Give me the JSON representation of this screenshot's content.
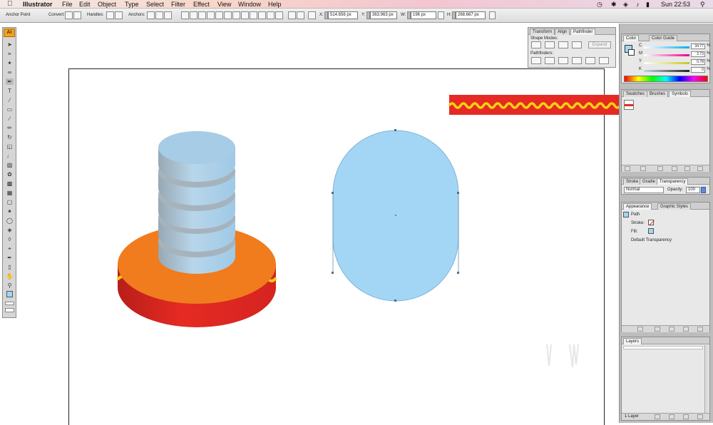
{
  "menubar": {
    "app_name": "Illustrator",
    "menus": [
      "File",
      "Edit",
      "Object",
      "Type",
      "Select",
      "Filter",
      "Effect",
      "View",
      "Window",
      "Help"
    ],
    "clock": "Sun 22:53"
  },
  "control_bar": {
    "tool_name": "Anchor Point",
    "convert_label": "Convert:",
    "handles_label": "Handles:",
    "anchors_label": "Anchors:",
    "x_label": "X:",
    "x_value": "514.656 px",
    "y_label": "Y:",
    "y_value": "363.963 px",
    "w_label": "W:",
    "w_value": "196 px",
    "h_label": "H:",
    "h_value": "268.667 px"
  },
  "toolbox": {
    "logo": "Ai",
    "tools": [
      "selection-tool-icon",
      "direct-selection-tool-icon",
      "magic-wand-tool-icon",
      "lasso-tool-icon",
      "pen-tool-icon",
      "type-tool-icon",
      "line-tool-icon",
      "rectangle-tool-icon",
      "paintbrush-tool-icon",
      "pencil-tool-icon",
      "rotate-tool-icon",
      "scale-tool-icon",
      "warp-tool-icon",
      "free-transform-tool-icon",
      "symbol-sprayer-tool-icon",
      "column-graph-tool-icon",
      "mesh-tool-icon",
      "gradient-tool-icon",
      "eyedropper-tool-icon",
      "blend-tool-icon",
      "live-paint-bucket-tool-icon",
      "live-paint-selection-tool-icon",
      "crop-area-tool-icon",
      "slice-tool-icon",
      "eraser-tool-icon",
      "hand-tool-icon",
      "zoom-tool-icon"
    ]
  },
  "pathfinder_panel": {
    "tabs": [
      "Transform",
      "Align",
      "Pathfinder"
    ],
    "shape_modes_label": "Shape Modes:",
    "expand_label": "Expand",
    "pathfinders_label": "Pathfinders:"
  },
  "color_panel": {
    "tabs": [
      "Color",
      "Color Guide"
    ],
    "channels": [
      {
        "name": "C",
        "value": "34.77"
      },
      {
        "name": "M",
        "value": "2.73"
      },
      {
        "name": "Y",
        "value": "0.78"
      },
      {
        "name": "K",
        "value": "0"
      }
    ],
    "unit": "%",
    "fill_color": "#a3d6f4"
  },
  "swatches_panel": {
    "tabs": [
      "Swatches",
      "Brushes",
      "Symbols"
    ]
  },
  "stroke_panel": {
    "tabs": [
      "Stroke",
      "Gradie",
      "Transparency"
    ],
    "blend_mode": "Normal",
    "opacity_label": "Opacity:",
    "opacity_value": "100"
  },
  "appearance_panel": {
    "tabs": [
      "Appearance",
      "Graphic Styles"
    ],
    "target": "Path",
    "stroke_label": "Stroke:",
    "fill_label": "Fill:",
    "transparency_label": "Default Transparency"
  },
  "layers_panel": {
    "tabs": [
      "Layers"
    ],
    "footer_text": "1 Layer"
  },
  "artwork": {
    "blue": "#a3d6f4",
    "orange": "#f07c1e",
    "red": "#e52a23",
    "yellow": "#f8d210"
  }
}
